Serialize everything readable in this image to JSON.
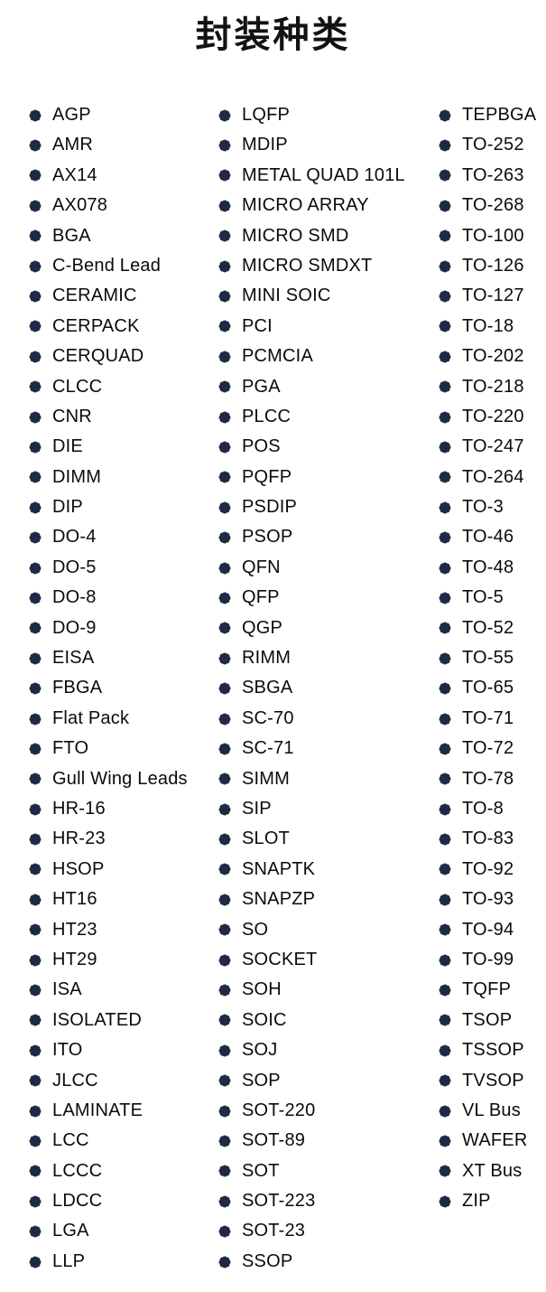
{
  "document": {
    "title": "封装种类",
    "bullet_icon": "flower-bullet-icon",
    "bullet_color": "#1f2a44",
    "text_color": "#0b0b0b",
    "background_color": "#ffffff",
    "column_count": 3
  },
  "columns": [
    {
      "index": 0,
      "items": [
        "AGP",
        "AMR",
        "AX14",
        "AX078",
        "BGA",
        "C-Bend Lead",
        "CERAMIC",
        "CERPACK",
        "CERQUAD",
        "CLCC",
        "CNR",
        "DIE",
        "DIMM",
        "DIP",
        "DO-4",
        "DO-5",
        "DO-8",
        "DO-9",
        "EISA",
        "FBGA",
        "Flat Pack",
        "FTO",
        "Gull Wing Leads",
        "HR-16",
        "HR-23",
        "HSOP",
        "HT16",
        "HT23",
        "HT29",
        "ISA",
        "ISOLATED",
        "ITO",
        "JLCC",
        "LAMINATE",
        "LCC",
        "LCCC",
        "LDCC",
        "LGA",
        "LLP"
      ]
    },
    {
      "index": 1,
      "items": [
        "LQFP",
        "MDIP",
        "METAL QUAD 101L",
        "MICRO ARRAY",
        "MICRO SMD",
        "MICRO SMDXT",
        "MINI SOIC",
        "PCI",
        "PCMCIA",
        "PGA",
        "PLCC",
        "POS",
        "PQFP",
        "PSDIP",
        "PSOP",
        "QFN",
        "QFP",
        "QGP",
        "RIMM",
        "SBGA",
        "SC-70",
        "SC-71",
        "SIMM",
        "SIP",
        "SLOT",
        "SNAPTK",
        "SNAPZP",
        "SO",
        "SOCKET",
        "SOH",
        "SOIC",
        "SOJ",
        "SOP",
        "SOT-220",
        "SOT-89",
        "SOT",
        "SOT-223",
        "SOT-23",
        "SSOP"
      ]
    },
    {
      "index": 2,
      "items": [
        "TEPBGA",
        "TO-252",
        "TO-263",
        "TO-268",
        "TO-100",
        "TO-126",
        "TO-127",
        "TO-18",
        "TO-202",
        "TO-218",
        "TO-220",
        "TO-247",
        "TO-264",
        "TO-3",
        "TO-46",
        "TO-48",
        "TO-5",
        "TO-52",
        "TO-55",
        "TO-65",
        "TO-71",
        "TO-72",
        "TO-78",
        "TO-8",
        "TO-83",
        "TO-92",
        "TO-93",
        "TO-94",
        "TO-99",
        "TQFP",
        "TSOP",
        "TSSOP",
        "TVSOP",
        "VL Bus",
        "WAFER",
        "XT Bus",
        "ZIP"
      ]
    }
  ]
}
